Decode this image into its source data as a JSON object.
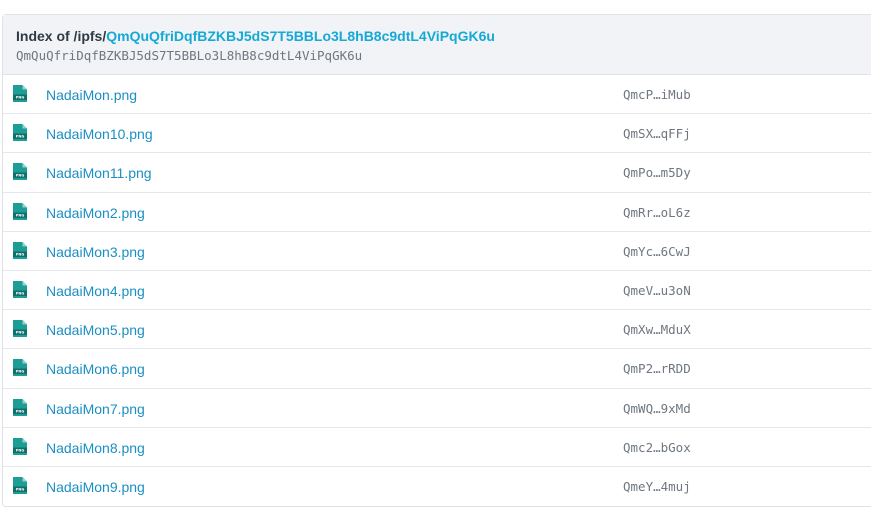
{
  "header": {
    "index_prefix": "Index of /ipfs/",
    "cid_link": "QmQuQfriDqfBZKBJ5dS7T5BBLo3L8hB8c9dtL4ViPqGK6u",
    "cid": "QmQuQfriDqfBZKBJ5dS7T5BBLo3L8hB8c9dtL4ViPqGK6u"
  },
  "files": [
    {
      "name": "NadaiMon.png",
      "hash": "QmcP…iMub",
      "icon": "png-file-icon",
      "icon_label": "PNG"
    },
    {
      "name": "NadaiMon10.png",
      "hash": "QmSX…qFFj",
      "icon": "png-file-icon",
      "icon_label": "PNG"
    },
    {
      "name": "NadaiMon11.png",
      "hash": "QmPo…m5Dy",
      "icon": "png-file-icon",
      "icon_label": "PNG"
    },
    {
      "name": "NadaiMon2.png",
      "hash": "QmRr…oL6z",
      "icon": "png-file-icon",
      "icon_label": "PNG"
    },
    {
      "name": "NadaiMon3.png",
      "hash": "QmYc…6CwJ",
      "icon": "png-file-icon",
      "icon_label": "PNG"
    },
    {
      "name": "NadaiMon4.png",
      "hash": "QmeV…u3oN",
      "icon": "png-file-icon",
      "icon_label": "PNG"
    },
    {
      "name": "NadaiMon5.png",
      "hash": "QmXw…MduX",
      "icon": "png-file-icon",
      "icon_label": "PNG"
    },
    {
      "name": "NadaiMon6.png",
      "hash": "QmP2…rRDD",
      "icon": "png-file-icon",
      "icon_label": "PNG"
    },
    {
      "name": "NadaiMon7.png",
      "hash": "QmWQ…9xMd",
      "icon": "png-file-icon",
      "icon_label": "PNG"
    },
    {
      "name": "NadaiMon8.png",
      "hash": "Qmc2…bGox",
      "icon": "png-file-icon",
      "icon_label": "PNG"
    },
    {
      "name": "NadaiMon9.png",
      "hash": "QmeY…4muj",
      "icon": "png-file-icon",
      "icon_label": "PNG"
    }
  ],
  "colors": {
    "link": "#1a8fc4",
    "header_link": "#15a9d6",
    "icon_teal": "#1c9d95",
    "header_bg": "#f1f3f6"
  }
}
